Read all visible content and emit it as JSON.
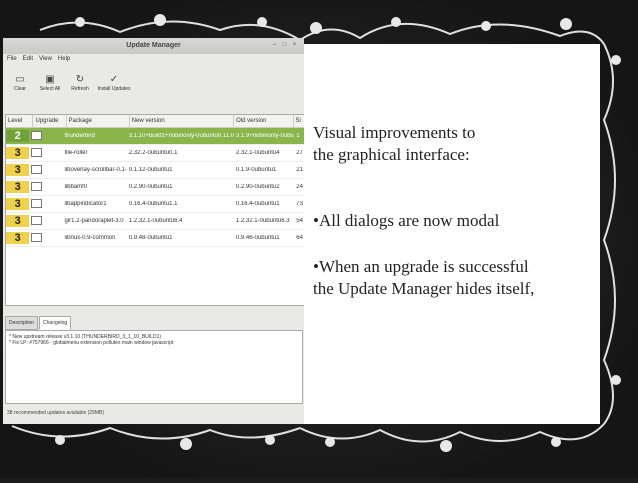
{
  "window": {
    "title": "Update Manager",
    "menu": [
      "File",
      "Edit",
      "View",
      "Help"
    ],
    "toolbar": [
      "Clear",
      "Select All",
      "Refresh",
      "Install Updates"
    ],
    "columns": [
      "Level",
      "Upgrade",
      "Package",
      "New version",
      "Old version",
      "Si"
    ],
    "rows": [
      {
        "level": "2",
        "package": "thunderbird",
        "new": "3.1.10+build1+nobinonly-0ubuntu0.11.04.1",
        "old": "3.1.9+nobinonly-0ubuntu0.11.04",
        "size": "1",
        "selected": true
      },
      {
        "level": "3",
        "package": "file-roller",
        "new": "2.32.2-0ubuntu0.1",
        "old": "2.32.1-0ubuntu4",
        "size": "27",
        "selected": false
      },
      {
        "level": "3",
        "package": "liboverlay-scrollbar-0.1-0",
        "new": "0.1.12-0ubuntu1",
        "old": "0.1.9-0ubuntu1",
        "size": "21",
        "selected": false
      },
      {
        "level": "3",
        "package": "libbamf0",
        "new": "0.2.90-0ubuntu1",
        "old": "0.2.90-0ubuntu2",
        "size": "24",
        "selected": false
      },
      {
        "level": "3",
        "package": "libappindicator1",
        "new": "0.16.4-0ubuntu1.1",
        "old": "0.16.4-0ubuntu1",
        "size": "73",
        "selected": false
      },
      {
        "level": "3",
        "package": "gir1.2-pandoraplet-3.0",
        "new": "1.2.32.1-0ubuntu6.4",
        "old": "1.2.32.1-0ubuntu6.3",
        "size": "54",
        "selected": false
      },
      {
        "level": "3",
        "package": "libnux-0.9-common",
        "new": "0.9.48-0ubuntu1",
        "old": "0.9.46-0ubuntu1",
        "size": "64",
        "selected": false
      }
    ],
    "tabs": [
      "Description",
      "Changelog"
    ],
    "changelog": [
      "* New upstream release v3.1.10 (THUNDERBIRD_3_1_10_BUILD1)",
      "* Fix LP: #757966 - globalmenu extension pollutes main window javascript"
    ],
    "status": "38 recommended updates available (29MB)"
  },
  "slide": {
    "heading_line1": "Visual improvements to",
    "heading_line2": "the graphical interface:",
    "bullet1": "•All dialogs are now modal",
    "bullet2_line1": "•When an upgrade is successful",
    "bullet2_line2": "the Update Manager hides itself,"
  }
}
